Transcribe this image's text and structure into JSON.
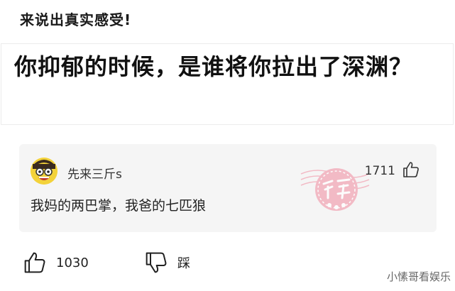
{
  "header": {
    "hint": "来说出真实感受!"
  },
  "question": {
    "text": "你抑郁的时候，是谁将你拉出了深渊？"
  },
  "comment": {
    "username": "先来三斤s",
    "like_count": "1711",
    "text": "我妈的两巴掌，我爸的七匹狼",
    "badge_text": "神评",
    "avatar_color": "#f3d23a",
    "stamp_color": "#f2a7b5"
  },
  "actions": {
    "like_count": "1030",
    "dislike_label": "踩",
    "like_icon": "thumbs-up-icon",
    "dislike_icon": "thumbs-down-icon"
  },
  "watermark": {
    "text": "小愫哥看娱乐"
  }
}
